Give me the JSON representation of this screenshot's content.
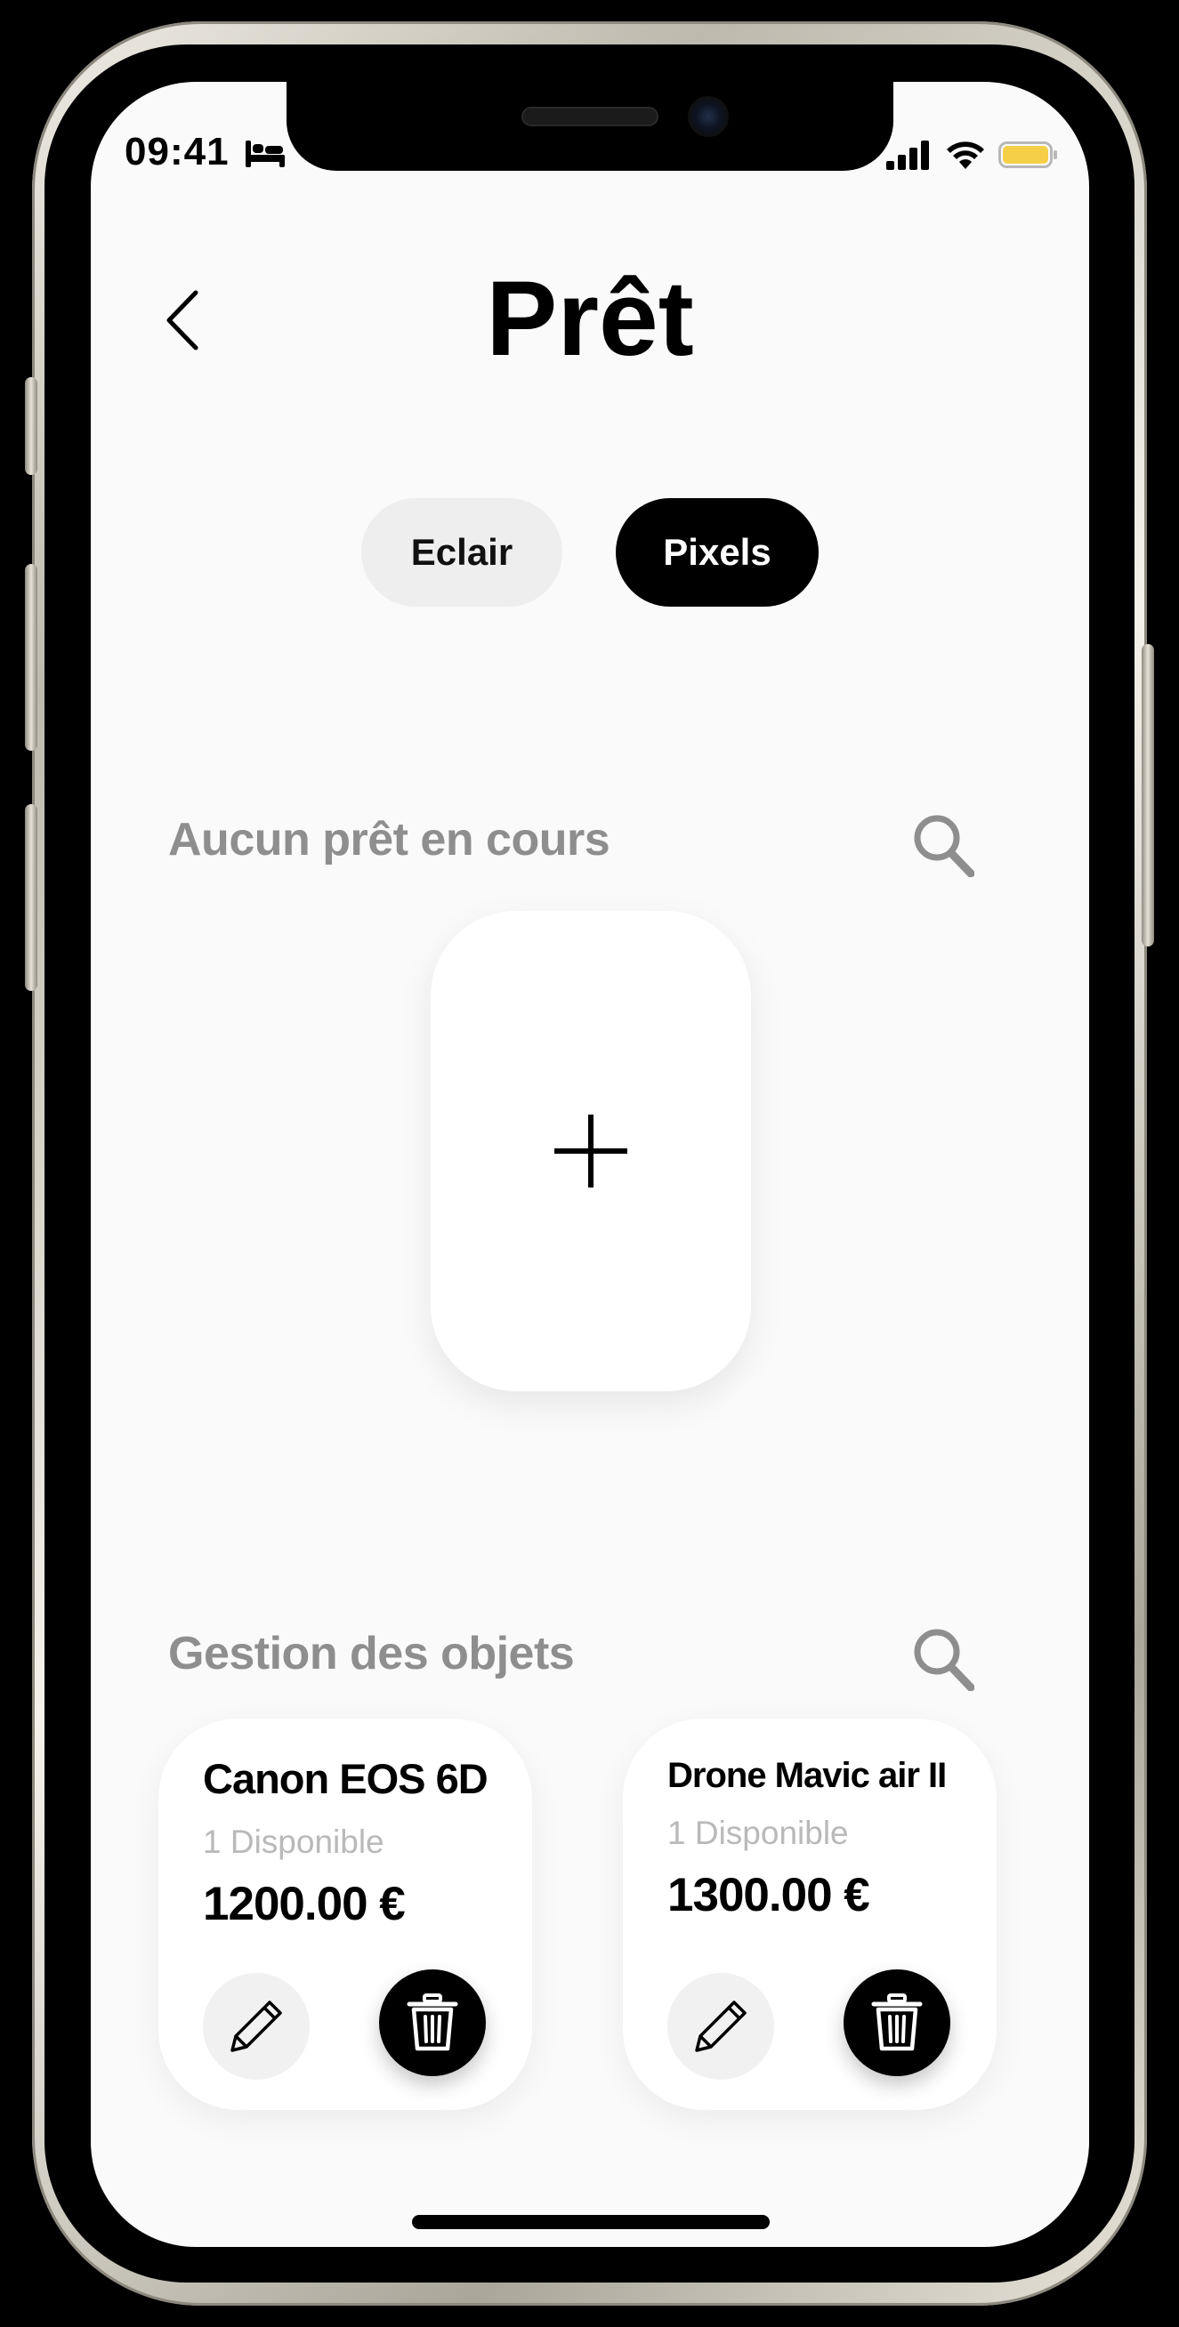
{
  "status_bar": {
    "time": "09:41",
    "icons": [
      "bed-icon",
      "cellular-signal-icon",
      "wifi-icon",
      "battery-icon"
    ],
    "battery_color": "#f5cf47"
  },
  "header": {
    "back_icon": "chevron-left-icon",
    "title": "Prêt"
  },
  "toggles": [
    {
      "label": "Eclair",
      "selected": false
    },
    {
      "label": "Pixels",
      "selected": true
    }
  ],
  "loans_section": {
    "title": "Aucun prêt en cours",
    "search_icon": "search-icon",
    "add_icon": "plus-icon"
  },
  "objects_section": {
    "title": "Gestion des objets",
    "search_icon": "search-icon"
  },
  "items": [
    {
      "name": "Canon EOS 6D",
      "availability": "1 Disponible",
      "price": "1200.00 €"
    },
    {
      "name": "Drone Mavic air II",
      "availability": "1 Disponible",
      "price": "1300.00 €"
    }
  ],
  "colors": {
    "accent": "#000000",
    "background": "#fafafa",
    "muted_text": "#8e8e8e",
    "secondary_text": "#b9b9b9"
  }
}
